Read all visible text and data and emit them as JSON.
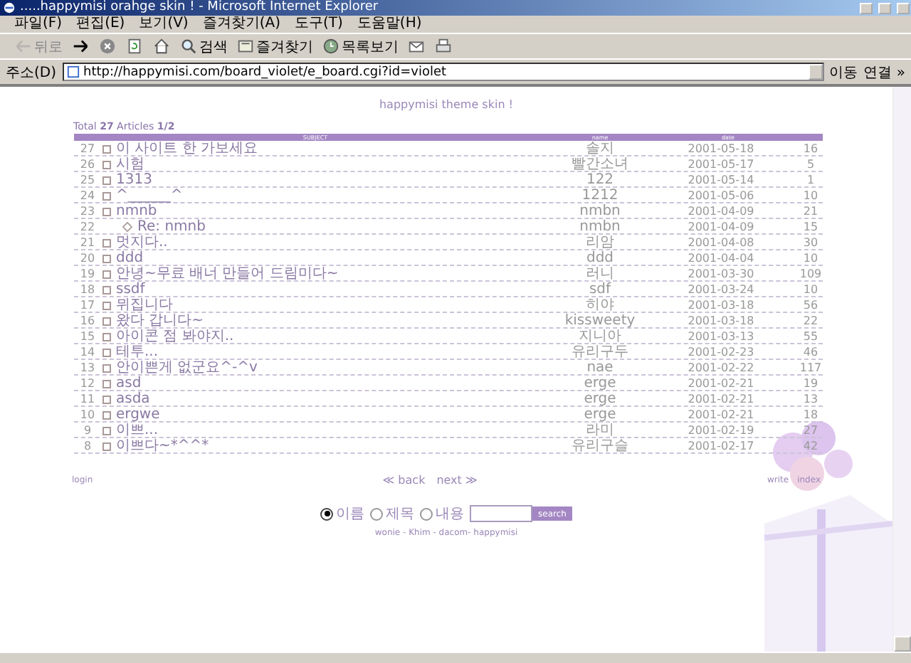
{
  "window": {
    "title": ".....happymisi orahge skin ! - Microsoft Internet Explorer"
  },
  "menu": [
    "파일(F)",
    "편집(E)",
    "보기(V)",
    "즐겨찾기(A)",
    "도구(T)",
    "도움말(H)"
  ],
  "toolbar": [
    {
      "kind": "back",
      "label": "뒤로",
      "disabled": true
    },
    {
      "kind": "forward",
      "disabled": false
    },
    {
      "kind": "stop",
      "disabled": false
    },
    {
      "kind": "refresh",
      "disabled": false
    },
    {
      "kind": "home",
      "disabled": false
    },
    {
      "kind": "search",
      "label": "검색",
      "disabled": false
    },
    {
      "kind": "favorites",
      "label": "즐겨찾기",
      "disabled": false
    },
    {
      "kind": "history",
      "label": "목록보기",
      "disabled": false
    },
    {
      "kind": "mail",
      "disabled": false
    },
    {
      "kind": "print",
      "disabled": false
    }
  ],
  "address": {
    "label": "주소(D)",
    "url": "http://happymisi.com/board_violet/e_board.cgi?id=violet",
    "go": "이동",
    "links": "연결 »"
  },
  "page": {
    "heading": "happymisi theme skin !",
    "summary": "Total **27** Articles **1/2**",
    "columns": [
      "SUBJECT",
      "name",
      "date"
    ],
    "rows": [
      {
        "no": "27",
        "kind": "post",
        "subject": "이 사이트 한 가보세요",
        "name": "솔지",
        "date": "2001-05-18",
        "hits": "16"
      },
      {
        "no": "26",
        "kind": "post",
        "subject": "시험",
        "name": "빨간소녀",
        "date": "2001-05-17",
        "hits": "5"
      },
      {
        "no": "25",
        "kind": "post",
        "subject": "1313",
        "name": "122",
        "date": "2001-05-14",
        "hits": "1"
      },
      {
        "no": "24",
        "kind": "post",
        "subject": "^______^",
        "name": "1212",
        "date": "2001-05-06",
        "hits": "10"
      },
      {
        "no": "23",
        "kind": "post",
        "subject": "nmnb",
        "name": "nmbn",
        "date": "2001-04-09",
        "hits": "21"
      },
      {
        "no": "22",
        "kind": "reply",
        "subject": "Re: nmnb",
        "name": "nmbn",
        "date": "2001-04-09",
        "hits": "15"
      },
      {
        "no": "21",
        "kind": "post",
        "subject": "멋지다..",
        "name": "리암",
        "date": "2001-04-08",
        "hits": "30"
      },
      {
        "no": "20",
        "kind": "post",
        "subject": "ddd",
        "name": "ddd",
        "date": "2001-04-04",
        "hits": "10"
      },
      {
        "no": "19",
        "kind": "post",
        "subject": "안녕~무료 배너 만들어 드림미다~",
        "name": "러니",
        "date": "2001-03-30",
        "hits": "109"
      },
      {
        "no": "18",
        "kind": "post",
        "subject": "ssdf",
        "name": "sdf",
        "date": "2001-03-24",
        "hits": "10"
      },
      {
        "no": "17",
        "kind": "post",
        "subject": "뮈집니다",
        "name": "히야",
        "date": "2001-03-18",
        "hits": "56"
      },
      {
        "no": "16",
        "kind": "post",
        "subject": "왔다 갑니다~",
        "name": "kissweety",
        "date": "2001-03-18",
        "hits": "22"
      },
      {
        "no": "15",
        "kind": "post",
        "subject": "아이콘 점 봐야지..",
        "name": "지니아",
        "date": "2001-03-13",
        "hits": "55"
      },
      {
        "no": "14",
        "kind": "post",
        "subject": "테투...",
        "name": "유리구두",
        "date": "2001-02-23",
        "hits": "46"
      },
      {
        "no": "13",
        "kind": "post",
        "subject": "안이쁜게 없군요^-^v",
        "name": "nae",
        "date": "2001-02-22",
        "hits": "117"
      },
      {
        "no": "12",
        "kind": "post",
        "subject": "asd",
        "name": "erge",
        "date": "2001-02-21",
        "hits": "19"
      },
      {
        "no": "11",
        "kind": "post",
        "subject": "asda",
        "name": "erge",
        "date": "2001-02-21",
        "hits": "13"
      },
      {
        "no": "10",
        "kind": "post",
        "subject": "ergwe",
        "name": "erge",
        "date": "2001-02-21",
        "hits": "18"
      },
      {
        "no": "9",
        "kind": "post",
        "subject": "이쁘...",
        "name": "라미",
        "date": "2001-02-19",
        "hits": "27"
      },
      {
        "no": "8",
        "kind": "post",
        "subject": "이쁘다~*^^*",
        "name": "유리구슬",
        "date": "2001-02-17",
        "hits": "42"
      }
    ],
    "login": "login",
    "back": "≪ back",
    "next": "next ≫",
    "write": "write",
    "index": "index",
    "search_options": [
      {
        "label": "이름",
        "selected": true
      },
      {
        "label": "제목",
        "selected": false
      },
      {
        "label": "내용",
        "selected": false
      }
    ],
    "search_button": "search",
    "credits": "wonie - Khim - dacom- happymisi"
  }
}
